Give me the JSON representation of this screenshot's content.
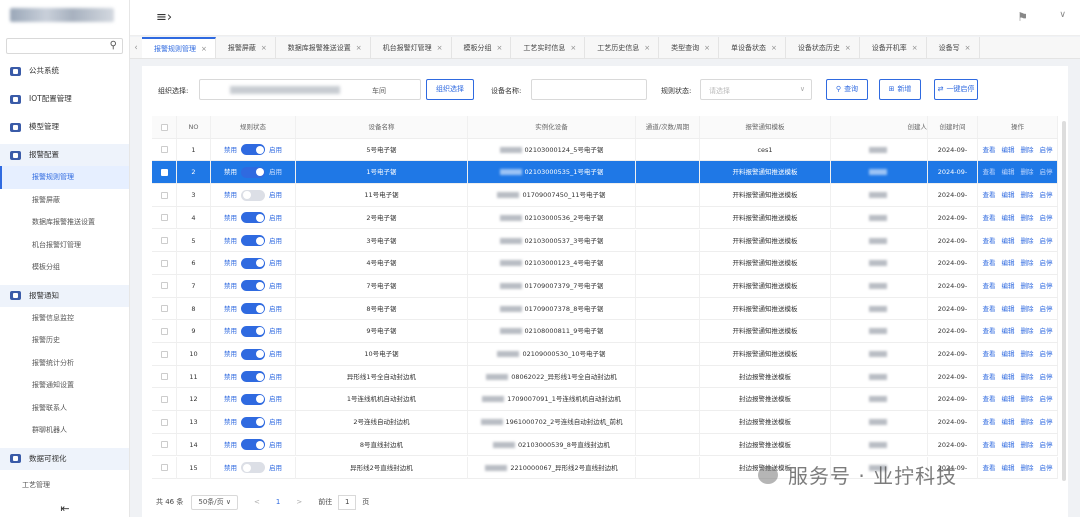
{
  "sidebar": {
    "search_icon": "search-icon",
    "groups": [
      {
        "label": "公共系统"
      },
      {
        "label": "IOT配置管理"
      },
      {
        "label": "模型管理"
      },
      {
        "label": "报警配置"
      },
      {
        "label": "报警通知"
      },
      {
        "label": "数据可视化"
      }
    ],
    "alarm_config_items": [
      "报警规则管理",
      "报警屏蔽",
      "数据库报警推送设置",
      "机台报警灯管理",
      "模板分组"
    ],
    "alarm_notify_items": [
      "报警信息监控",
      "报警历史",
      "报警统计分析",
      "报警通知设置",
      "报警联系人",
      "群聊机器人"
    ],
    "last_item": "工艺管理"
  },
  "tabs": [
    {
      "label": "报警规则管理",
      "active": true
    },
    {
      "label": "报警屏蔽"
    },
    {
      "label": "数据库报警推送设置"
    },
    {
      "label": "机台报警灯管理"
    },
    {
      "label": "模板分组"
    },
    {
      "label": "工艺实时信息"
    },
    {
      "label": "工艺历史信息"
    },
    {
      "label": "类型查询"
    },
    {
      "label": "单设备状态"
    },
    {
      "label": "设备状态历史"
    },
    {
      "label": "设备开机率"
    },
    {
      "label": "设备写"
    }
  ],
  "filters": {
    "org_label": "组织选择:",
    "org_value_suffix": "车间",
    "org_clear": "组织选择",
    "device_label": "设备名称:",
    "rule_status_label": "规则状态:",
    "rule_status_placeholder": "请选择",
    "query_btn": "查询",
    "add_btn": "新增",
    "enable_btn": "一键启停"
  },
  "table": {
    "headers": [
      "NO",
      "规则状态",
      "设备名称",
      "实例化设备",
      "通道/次数/周期",
      "报警通知模板",
      "创建人",
      "创建时间",
      "操作"
    ],
    "status_off_label": "禁用",
    "status_on_label": "启用",
    "ops": [
      "查看",
      "编辑",
      "删除",
      "启停"
    ],
    "rows": [
      {
        "no": "1",
        "on": true,
        "device": "5号电子锯",
        "instance": "02103000124_5号电子锯",
        "template": "ces1",
        "time": "2024-09-"
      },
      {
        "no": "2",
        "on": true,
        "device": "1号电子锯",
        "instance": "02103000535_1号电子锯",
        "template": "开料报警通知推送模板",
        "time": "2024-09-",
        "selected": true
      },
      {
        "no": "3",
        "on": false,
        "device": "11号电子锯",
        "instance": "01709007450_11号电子锯",
        "template": "开料报警通知推送模板",
        "time": "2024-09-"
      },
      {
        "no": "4",
        "on": true,
        "device": "2号电子锯",
        "instance": "02103000536_2号电子锯",
        "template": "开料报警通知推送模板",
        "time": "2024-09-"
      },
      {
        "no": "5",
        "on": true,
        "device": "3号电子锯",
        "instance": "02103000537_3号电子锯",
        "template": "开料报警通知推送模板",
        "time": "2024-09-"
      },
      {
        "no": "6",
        "on": true,
        "device": "4号电子锯",
        "instance": "02103000123_4号电子锯",
        "template": "开料报警通知推送模板",
        "time": "2024-09-"
      },
      {
        "no": "7",
        "on": true,
        "device": "7号电子锯",
        "instance": "01709007379_7号电子锯",
        "template": "开料报警通知推送模板",
        "time": "2024-09-"
      },
      {
        "no": "8",
        "on": true,
        "device": "8号电子锯",
        "instance": "01709007378_8号电子锯",
        "template": "开料报警通知推送模板",
        "time": "2024-09-"
      },
      {
        "no": "9",
        "on": true,
        "device": "9号电子锯",
        "instance": "02108000811_9号电子锯",
        "template": "开料报警通知推送模板",
        "time": "2024-09-"
      },
      {
        "no": "10",
        "on": true,
        "device": "10号电子锯",
        "instance": "02109000530_10号电子锯",
        "template": "开料报警通知推送模板",
        "time": "2024-09-"
      },
      {
        "no": "11",
        "on": true,
        "device": "异形线1号全自动封边机",
        "instance": "08062022_异形线1号全自动封边机",
        "template": "封边报警推送模板",
        "time": "2024-09-"
      },
      {
        "no": "12",
        "on": true,
        "device": "1号连线机机自动封边机",
        "instance": "1709007091_1号连线机机自动封边机",
        "template": "封边报警推送模板",
        "time": "2024-09-"
      },
      {
        "no": "13",
        "on": true,
        "device": "2号连线自动封边机",
        "instance": "1961000702_2号连线自动封边机_前机",
        "template": "封边报警推送模板",
        "time": "2024-09-"
      },
      {
        "no": "14",
        "on": true,
        "device": "8号直线封边机",
        "instance": "02103000539_8号直线封边机",
        "template": "封边报警推送模板",
        "time": "2024-09-"
      },
      {
        "no": "15",
        "on": false,
        "device": "异形线2号直线封边机",
        "instance": "2210000067_异形线2号直线封边机",
        "template": "封边报警推送模板",
        "time": "2024-09-"
      }
    ]
  },
  "pager": {
    "total": "共 46 条",
    "page_size": "50条/页",
    "prev": "<",
    "page": "1",
    "next": ">",
    "goto_label": "前往",
    "goto_value": "1",
    "goto_suffix": "页"
  },
  "watermark": "服务号 · 业拧科技"
}
